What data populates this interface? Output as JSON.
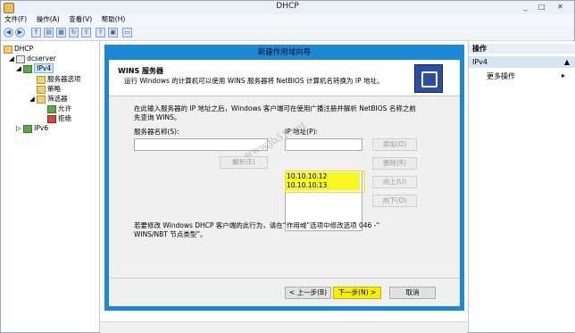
{
  "window": {
    "title": "DHCP",
    "controls": [
      "_",
      "□",
      "✕"
    ]
  },
  "menubar": [
    "文件(F)",
    "操作(A)",
    "查看(V)",
    "帮助(H)"
  ],
  "toolbar": {
    "icons": [
      "back-icon",
      "forward-icon",
      "up-icon",
      "show-tree-icon",
      "properties-icon",
      "refresh-icon",
      "export-icon",
      "help-icon",
      "console-icon",
      "computer-icon"
    ]
  },
  "tree": {
    "root": "DHCP",
    "server": "dcserver",
    "ipv4": "IPv4",
    "server_options": "服务器选项",
    "policies": "策略",
    "filters": "筛选器",
    "allow": "允许",
    "deny": "拒绝",
    "ipv6": "IPv6"
  },
  "actions": {
    "header": "操作",
    "section": "IPv4",
    "more": "更多操作"
  },
  "wizard": {
    "title": "新建作用域向导",
    "heading": "WINS 服务器",
    "subheading": "运行 Windows 的计算机可以使用 WINS 服务器将 NetBIOS 计算机名转换为 IP 地址。",
    "instruction_line1": "在此输入服务器的 IP 地址之后，Windows 客户端可在使用广播注册并解析 NetBIOS 名称之前",
    "instruction_line2": "先查询 WINS。",
    "server_name_label": "服务器名称(S):",
    "server_name_value": "",
    "ip_label": "IP 地址(P):",
    "ip_input_value": "",
    "resolve_button": "解析(E)",
    "add_button": "添加(D)",
    "remove_button": "删除(R)",
    "up_button": "向上(U)",
    "down_button": "向下(O)",
    "ip_list": [
      "10.10.10.12",
      "10.10.10.13"
    ],
    "note_line1": "若要修改 Windows DHCP 客户端的此行为，请在“作用域”选项中修改选项 046 -“",
    "note_line2": "WINS/NBT 节点类型”。",
    "back_button": "< 上一步(B)",
    "next_button": "下一步(N) >",
    "cancel_button": "取消"
  },
  "watermark": "www.jb51.net",
  "colors": {
    "wizard_frame": "#1e88d8",
    "highlight": "#f6f000"
  }
}
